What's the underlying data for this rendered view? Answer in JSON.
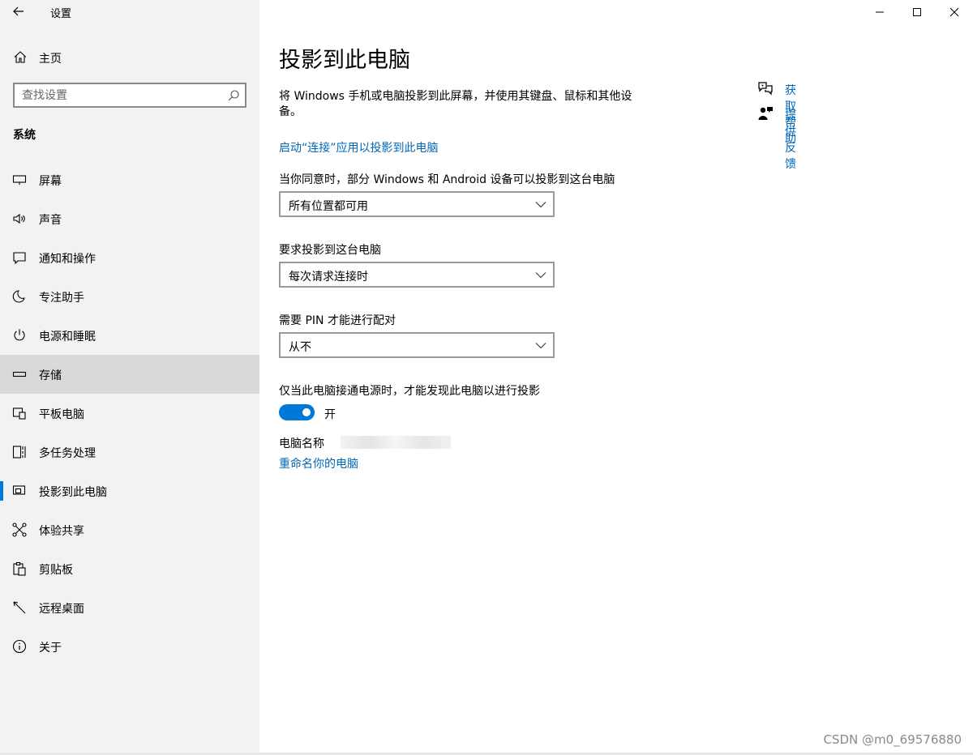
{
  "window": {
    "title": "设置",
    "controls": {
      "minimize": "minimize",
      "maximize": "maximize",
      "close": "close"
    }
  },
  "sidebar": {
    "home_label": "主页",
    "search": {
      "placeholder": "查找设置",
      "value": ""
    },
    "section_title": "系统",
    "items": [
      {
        "label": "屏幕",
        "icon": "display-icon"
      },
      {
        "label": "声音",
        "icon": "speaker-icon"
      },
      {
        "label": "通知和操作",
        "icon": "notification-icon"
      },
      {
        "label": "专注助手",
        "icon": "moon-icon"
      },
      {
        "label": "电源和睡眠",
        "icon": "power-icon"
      },
      {
        "label": "存储",
        "icon": "storage-icon",
        "state": "hover"
      },
      {
        "label": "平板电脑",
        "icon": "tablet-icon"
      },
      {
        "label": "多任务处理",
        "icon": "multitask-icon"
      },
      {
        "label": "投影到此电脑",
        "icon": "project-icon",
        "state": "selected"
      },
      {
        "label": "体验共享",
        "icon": "share-icon"
      },
      {
        "label": "剪贴板",
        "icon": "clipboard-icon"
      },
      {
        "label": "远程桌面",
        "icon": "remote-icon"
      },
      {
        "label": "关于",
        "icon": "info-icon"
      }
    ]
  },
  "main": {
    "title": "投影到此电脑",
    "description": "将 Windows 手机或电脑投影到此屏幕，并使用其键盘、鼠标和其他设备。",
    "launch_link": "启动“连接”应用以投影到此电脑",
    "availability": {
      "label": "当你同意时，部分 Windows 和 Android 设备可以投影到这台电脑",
      "value": "所有位置都可用"
    },
    "ask_to_project": {
      "label": "要求投影到这台电脑",
      "value": "每次请求连接时"
    },
    "require_pin": {
      "label": "需要 PIN 才能进行配对",
      "value": "从不"
    },
    "power_only": {
      "label": "仅当此电脑接通电源时，才能发现此电脑以进行投影",
      "toggle_state": "开",
      "on": true
    },
    "pc_name_label": "电脑名称",
    "rename_link": "重命名你的电脑"
  },
  "help": {
    "get_help": "获取帮助",
    "give_feedback": "提供反馈"
  },
  "watermark": "CSDN @m0_69576880",
  "colors": {
    "accent": "#0078d7",
    "link": "#0067b8",
    "sidebar_bg": "#f2f2f2",
    "selected_bg": "#d9d9d9"
  }
}
